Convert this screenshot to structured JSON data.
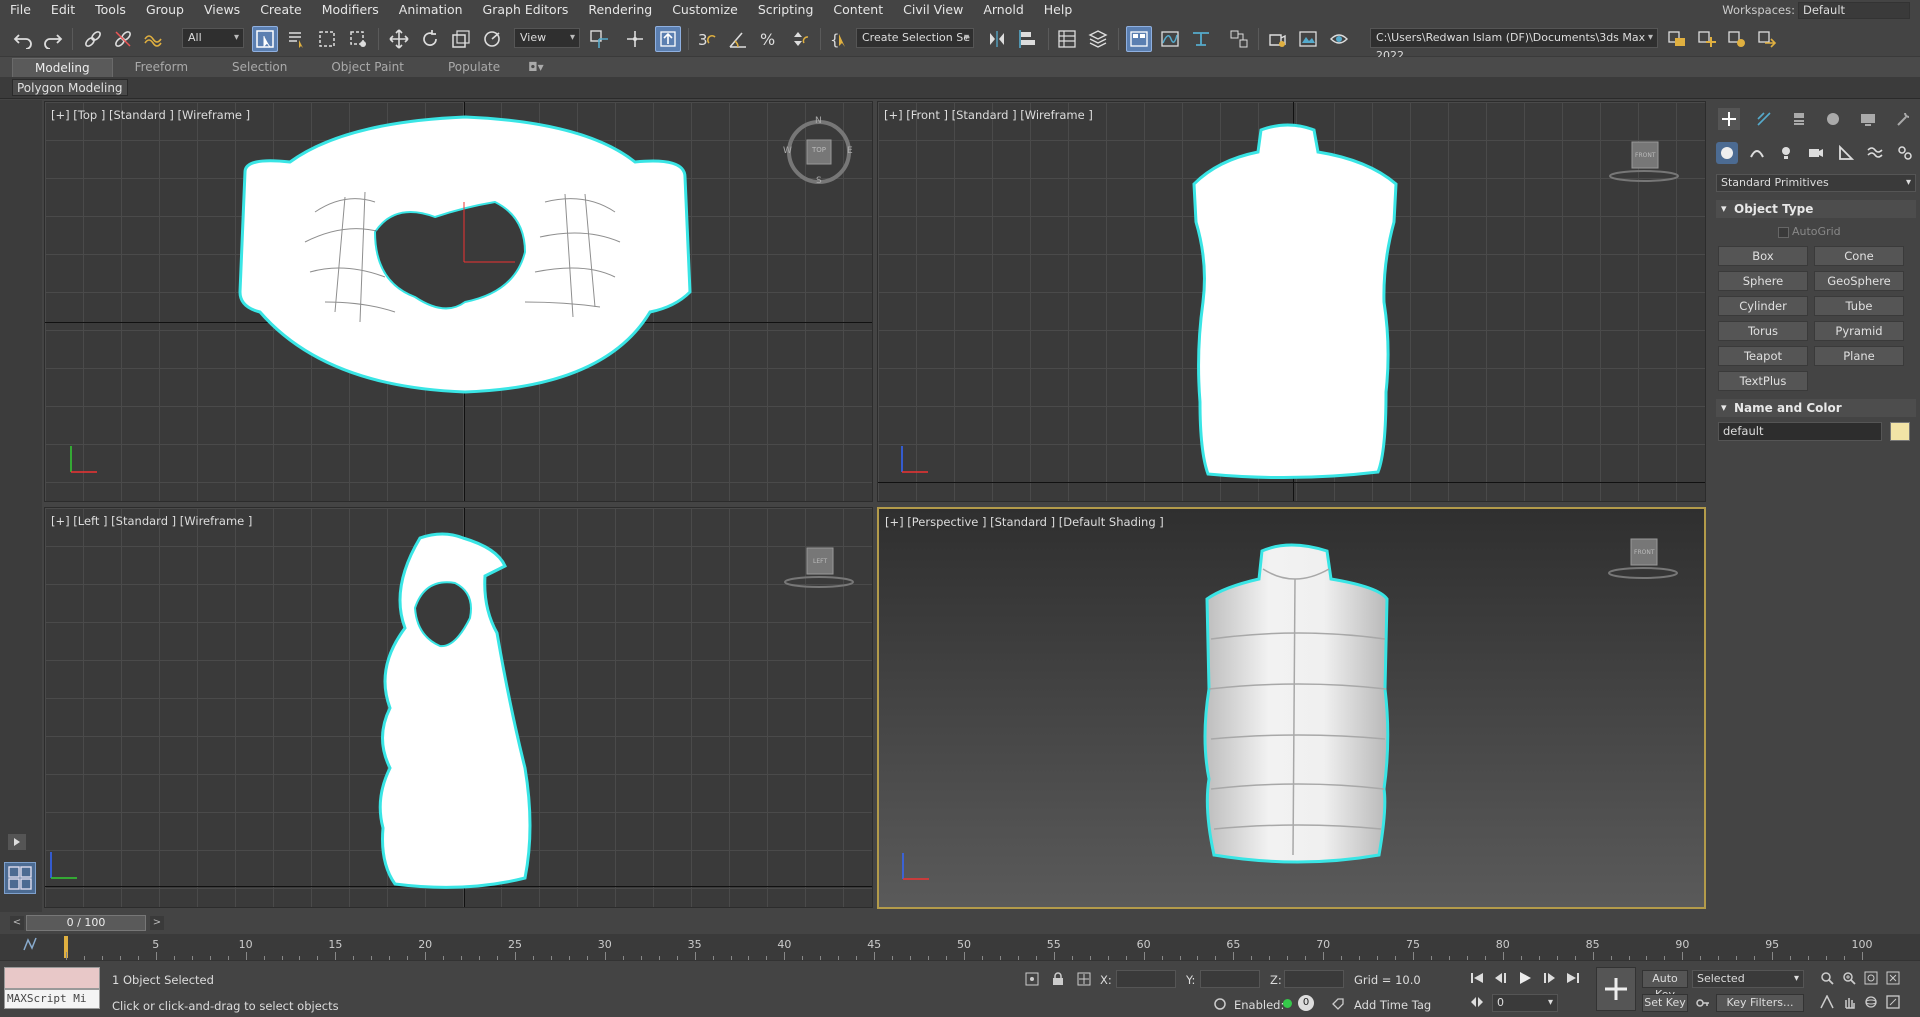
{
  "menu": [
    "File",
    "Edit",
    "Tools",
    "Group",
    "Views",
    "Create",
    "Modifiers",
    "Animation",
    "Graph Editors",
    "Rendering",
    "Customize",
    "Scripting",
    "Content",
    "Civil View",
    "Arnold",
    "Help"
  ],
  "workspaces": {
    "label": "Workspaces:",
    "value": "Default"
  },
  "toolbar": {
    "filter_value": "All",
    "ref_coord_value": "View",
    "selection_set_value": "Create Selection Se",
    "project_path": "C:\\Users\\Redwan Islam (DF)\\Documents\\3ds Max 2022"
  },
  "ribbon": {
    "tabs": [
      "Modeling",
      "Freeform",
      "Selection",
      "Object Paint",
      "Populate"
    ],
    "active_tab": "Modeling",
    "panel_label": "Polygon Modeling"
  },
  "viewports": {
    "top": {
      "label": "[+] [Top ] [Standard ] [Wireframe ]",
      "cube": "TOP",
      "compass": [
        "N",
        "S",
        "E",
        "W"
      ]
    },
    "front": {
      "label": "[+] [Front ] [Standard ] [Wireframe ]",
      "cube": "FRONT"
    },
    "left": {
      "label": "[+] [Left ] [Standard ] [Wireframe ]",
      "cube": "LEFT"
    },
    "perspective": {
      "label": "[+] [Perspective ] [Standard ] [Default Shading ]",
      "cube": "FRONT"
    }
  },
  "command_panel": {
    "category": "Standard Primitives",
    "object_type_title": "Object Type",
    "autogrid": "AutoGrid",
    "buttons": [
      "Box",
      "Cone",
      "Sphere",
      "GeoSphere",
      "Cylinder",
      "Tube",
      "Torus",
      "Pyramid",
      "Teapot",
      "Plane",
      "TextPlus"
    ],
    "name_color_title": "Name and Color",
    "name_value": "default",
    "color": "#f2e3a6"
  },
  "timeline": {
    "slider_text": "0 / 100",
    "ticks": [
      0,
      5,
      10,
      15,
      20,
      25,
      30,
      35,
      40,
      45,
      50,
      55,
      60,
      65,
      70,
      75,
      80,
      85,
      90,
      95,
      100
    ]
  },
  "status": {
    "maxscript": "MAXScript Mi",
    "selection_text": "1 Object Selected",
    "prompt_text": "Click or click-and-drag to select objects",
    "x_label": "X:",
    "y_label": "Y:",
    "z_label": "Z:",
    "grid_text": "Grid = 10.0",
    "enabled_label": "Enabled:",
    "enabled_value": "0",
    "add_time_tag": "Add Time Tag",
    "auto_key": "Auto Key",
    "set_key": "Set Key",
    "key_mode": "Selected",
    "frame_value": "0",
    "key_filters": "Key Filters..."
  }
}
